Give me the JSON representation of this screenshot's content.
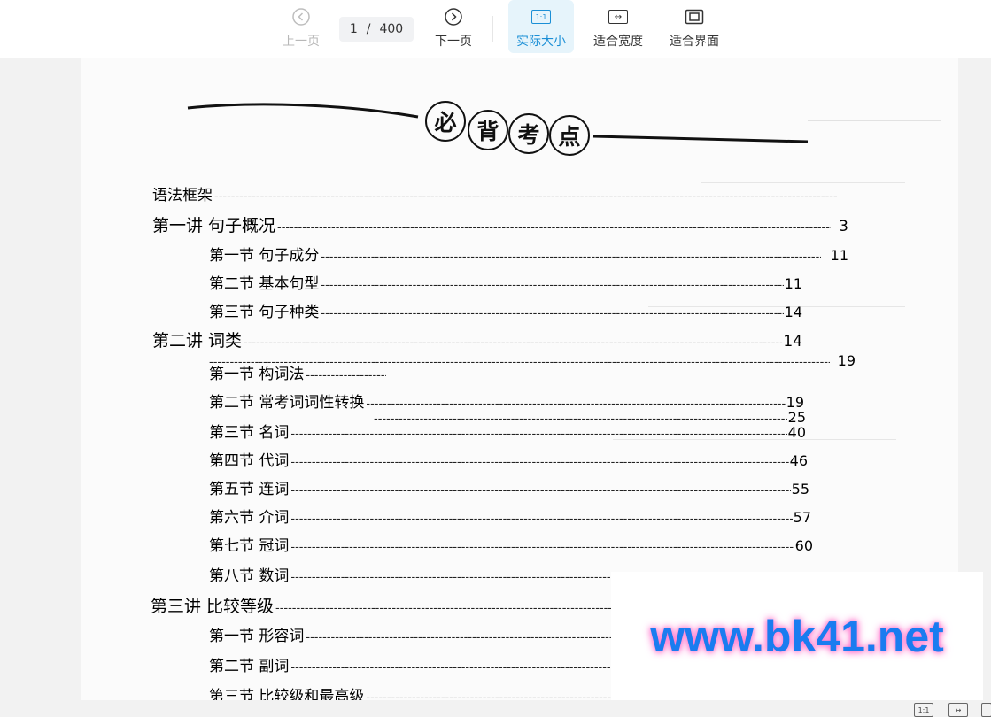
{
  "toolbar": {
    "prev_label": "上一页",
    "next_label": "下一页",
    "page_current": "1",
    "page_sep": "/",
    "page_total": "400",
    "actual_size_label": "实际大小",
    "actual_size_icon_text": "1:1",
    "fit_width_label": "适合宽度",
    "fit_width_icon_text": "↔",
    "fit_page_label": "适合界面"
  },
  "document": {
    "title_chars": [
      "必",
      "背",
      "考",
      "点"
    ],
    "toc": [
      {
        "text": "语法框架",
        "page": "",
        "level": "section"
      },
      {
        "text": "第一讲  句子概况",
        "page": "3",
        "level": "chapter"
      },
      {
        "text": "第一节  句子成分",
        "page": "11",
        "level": "item"
      },
      {
        "text": "第二节  基本句型",
        "page": "11",
        "level": "item"
      },
      {
        "text": "第三节  句子种类",
        "page": "14",
        "level": "item"
      },
      {
        "text": "第二讲  词类",
        "page": "14",
        "level": "chapter"
      },
      {
        "text": "",
        "page": "19",
        "level": "blank"
      },
      {
        "text": "第一节  构词法",
        "page": "",
        "level": "item"
      },
      {
        "text": "第二节  常考词词性转换",
        "page": "19",
        "level": "item"
      },
      {
        "text": "",
        "page": "25",
        "level": "blank"
      },
      {
        "text": "第三节  名词",
        "page": "40",
        "level": "item"
      },
      {
        "text": "第四节  代词",
        "page": "46",
        "level": "item"
      },
      {
        "text": "第五节  连词",
        "page": "55",
        "level": "item"
      },
      {
        "text": "第六节  介词",
        "page": "57",
        "level": "item"
      },
      {
        "text": "第七节  冠词",
        "page": "60",
        "level": "item"
      },
      {
        "text": "第八节  数词",
        "page": "",
        "level": "item"
      },
      {
        "text": "第三讲  比较等级",
        "page": "",
        "level": "chapter"
      },
      {
        "text": "第一节  形容词",
        "page": "",
        "level": "item"
      },
      {
        "text": "第二节  副词",
        "page": "",
        "level": "item"
      },
      {
        "text": "第三节  比较级和最高级",
        "page": "",
        "level": "item"
      }
    ]
  },
  "watermark": {
    "text": "www.bk41.net"
  },
  "statusbar": {
    "icon1_text": "1:1",
    "icon2_text": "↔"
  },
  "colors": {
    "accent": "#1b8fd6",
    "active_bg": "#e6f4fb",
    "watermark": "#1a7cf0"
  }
}
